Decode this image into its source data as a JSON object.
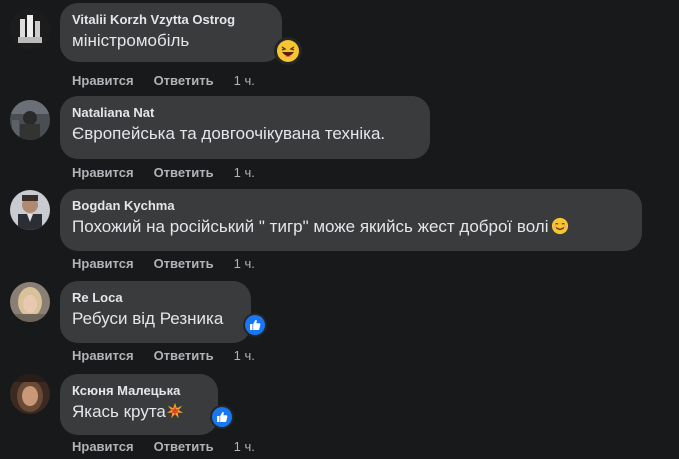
{
  "comments": [
    {
      "author": "Vitalii Korzh Vzytta Ostrog",
      "text": "міністромобіль",
      "like": "Нравится",
      "reply": "Ответить",
      "time": "1 ч.",
      "reaction": "laughing-emoji"
    },
    {
      "author": "Nataliana Nat",
      "text": "Європейська та довгоочікувана техніка.",
      "like": "Нравится",
      "reply": "Ответить",
      "time": "1 ч."
    },
    {
      "author": "Bogdan Kychma",
      "text": "Похожий на російський \" тигр\" може якийсь жест доброї волі",
      "like": "Нравится",
      "reply": "Ответить",
      "time": "1 ч.",
      "inline_emoji": "smiling-face-emoji"
    },
    {
      "author": "Re Loca",
      "text": "Ребуси від Резника",
      "like": "Нравится",
      "reply": "Ответить",
      "time": "1 ч.",
      "reaction": "like-reaction"
    },
    {
      "author": "Ксюня Малецька",
      "text": "Якась крута",
      "like": "Нравится",
      "reply": "Ответить",
      "time": "1 ч.",
      "inline_emoji": "collision-emoji",
      "reaction": "like-reaction"
    }
  ],
  "colors": {
    "background": "#18191a",
    "bubble": "#3a3b3c",
    "text": "#e4e6eb",
    "secondary": "#b0b3b8",
    "like_blue": "#1877f2"
  }
}
